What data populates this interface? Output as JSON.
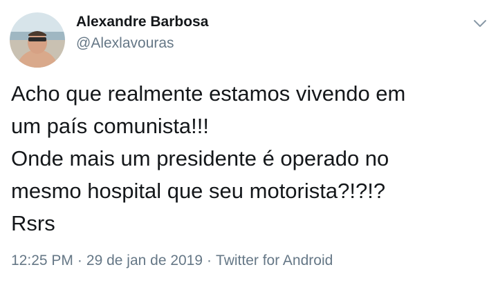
{
  "author": {
    "name": "Alexandre Barbosa",
    "handle": "@Alexlavouras"
  },
  "icons": {
    "menu": "chevron-down-icon",
    "avatar": "profile-photo"
  },
  "tweet": {
    "lines": [
      "Acho que realmente estamos vivendo em",
      "um país comunista!!!",
      "Onde mais um presidente é operado no",
      "mesmo hospital que seu motorista?!?!?",
      "Rsrs"
    ]
  },
  "meta": {
    "time": "12:25 PM",
    "separator": "·",
    "date": "29 de jan de 2019",
    "source": "Twitter for Android"
  },
  "colors": {
    "text": "#14171a",
    "secondary": "#657786",
    "background": "#ffffff"
  }
}
